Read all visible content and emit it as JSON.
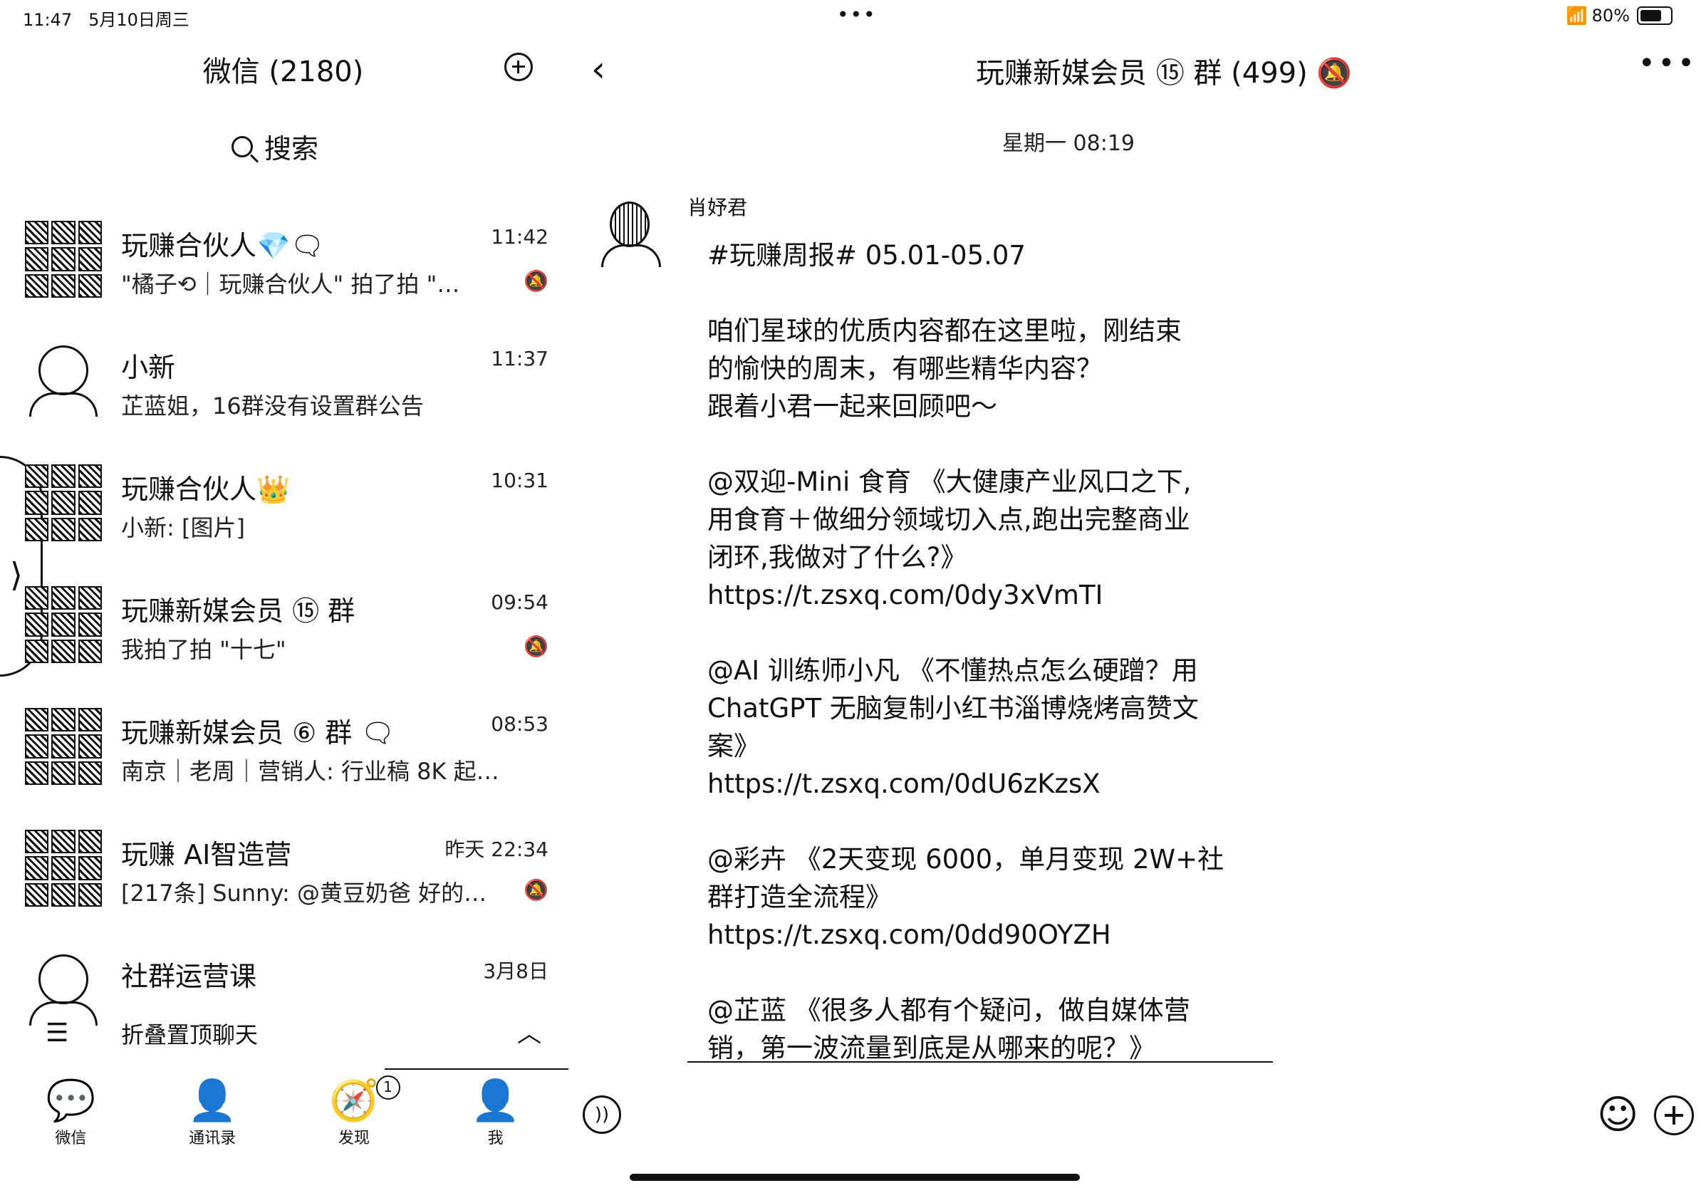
{
  "status": {
    "time": "11:47",
    "date": "5月10日周三",
    "dots": "•••",
    "battery": "80%",
    "battery_level": 0.8
  },
  "left": {
    "title": "微信 (2180)",
    "search_placeholder": "搜索",
    "chats": [
      {
        "name": "玩赚合伙人💎🗨",
        "time": "11:42",
        "preview": "\"橘子⟲｜玩赚合伙人\" 拍了拍 \"…",
        "muted": true,
        "avatar": "group-avatar"
      },
      {
        "name": "小新",
        "time": "11:37",
        "preview": "芷蓝姐，16群没有设置群公告",
        "muted": false,
        "avatar": "person-avatar"
      },
      {
        "name": "玩赚合伙人👑",
        "time": "10:31",
        "preview": "小新: [图片]",
        "muted": false,
        "avatar": "group-avatar"
      },
      {
        "name": "玩赚新媒会员 ⑮ 群",
        "time": "09:54",
        "preview": "我拍了拍 \"十七\"",
        "muted": true,
        "avatar": "group-avatar"
      },
      {
        "name": "玩赚新媒会员 ⑥ 群 🗨",
        "time": "08:53",
        "preview": "南京｜老周｜营销人: 行业稿 8K 起…",
        "muted": false,
        "avatar": "group-avatar"
      },
      {
        "name": "玩赚 AI智造营",
        "time": "昨天 22:34",
        "preview": "[217条] Sunny: @黄豆奶爸 好的…",
        "muted": true,
        "avatar": "group-avatar"
      },
      {
        "name": "社群运营课",
        "time": "3月8日",
        "preview": "",
        "muted": false,
        "avatar": "person-avatar"
      }
    ],
    "fold_label": "折叠置顶聊天",
    "tabs": [
      {
        "label": "微信",
        "icon": "chat-bubble-icon",
        "glyph": "💬"
      },
      {
        "label": "通讯录",
        "icon": "contacts-icon",
        "glyph": "👤"
      },
      {
        "label": "发现",
        "icon": "compass-icon",
        "glyph": "🧭",
        "badge": "1"
      },
      {
        "label": "我",
        "icon": "me-icon",
        "glyph": "👤"
      }
    ]
  },
  "right": {
    "room_title": "玩赚新媒会员 ⑮ 群 (499) 🔕",
    "time_divider": "星期一 08:19",
    "sender": "肖妤君",
    "message": "#玩赚周报# 05.01-05.07\n\n咱们星球的优质内容都在这里啦，刚结束\n的愉快的周末，有哪些精华内容？\n跟着小君一起来回顾吧～\n\n@双迎-Mini 食育 《大健康产业风口之下,\n用食育＋做细分领域切入点,跑出完整商业\n闭环,我做对了什么?》\nhttps://t.zsxq.com/0dy3xVmTI\n\n@AI 训练师小凡 《不懂热点怎么硬蹭？用\nChatGPT 无脑复制小红书淄博烧烤高赞文\n案》\nhttps://t.zsxq.com/0dU6zKzsX\n\n@彩卉 《2天变现 6000，单月变现 2W+社\n群打造全流程》\nhttps://t.zsxq.com/0dd90OYZH\n\n@芷蓝 《很多人都有个疑问，做自媒体营\n销，第一波流量到底是从哪来的呢？》"
  }
}
